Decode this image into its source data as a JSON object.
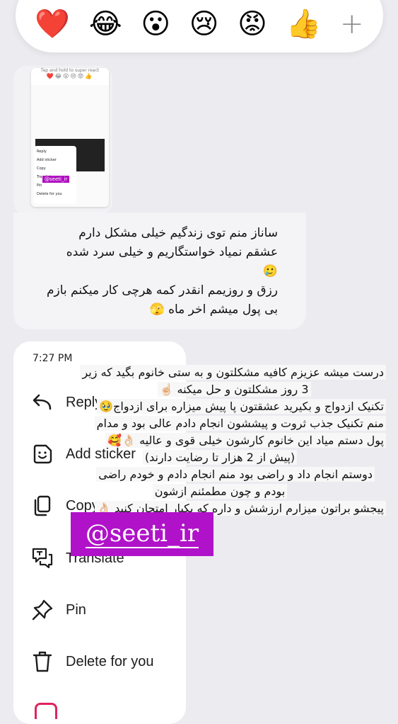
{
  "reactions": [
    {
      "emoji": "❤️",
      "name": "heart-reaction"
    },
    {
      "emoji": "😂",
      "name": "laughing-reaction"
    },
    {
      "emoji": "😮",
      "name": "wow-reaction"
    },
    {
      "emoji": "😢",
      "name": "sad-reaction"
    },
    {
      "emoji": "😡",
      "name": "angry-reaction"
    },
    {
      "emoji": "👍",
      "name": "thumbs-up-reaction"
    }
  ],
  "add_reaction": "+",
  "thumbnail": {
    "header": "Tap and hold to super react",
    "emoji_row": "❤️😂😮😢😡👍",
    "menu": [
      "Reply",
      "Add sticker",
      "Copy",
      "Translate",
      "Pin",
      "Delete for you"
    ],
    "tag": "@seeti_ir"
  },
  "message": {
    "lines": [
      "ساناز منم توی زندگیم خیلی مشکل دارم",
      "عشقم نمیاد خواستگاریم و خیلی سرد شده",
      "🥲",
      "رزق و روزیمم انقدر کمه هرچی کار میکنم بازم",
      "بی پول میشم اخر ماه 🫣"
    ]
  },
  "menu": {
    "time": "7:27 PM",
    "items": [
      {
        "label": "Reply",
        "icon": "reply-icon"
      },
      {
        "label": "Add sticker",
        "icon": "sticker-icon"
      },
      {
        "label": "Copy",
        "icon": "copy-icon"
      },
      {
        "label": "Translate",
        "icon": "translate-icon"
      },
      {
        "label": "Pin",
        "icon": "pin-icon"
      },
      {
        "label": "Delete for you",
        "icon": "trash-icon"
      }
    ]
  },
  "overlay_text": [
    "درست میشه عزیزم کافیه مشکلتون و به ستی خانوم بگید که زیر",
    "3 روز مشکلتون و حل میکنه ☝🏻",
    "تکنیک ازدواج و بکیرید عشقتون پا پیش میزاره برای ازدواج🥹",
    "منم تکنیک جذب ثروت و پیششون انجام دادم عالی بود و مدام",
    "پول دستم میاد این خانوم کارشون خیلی قوی و عالیه 👌🏻🥰",
    "(پیش از 2 هزار تا رضایت دارند)",
    "دوستم انجام داد و راضی بود منم انجام دادم و خودم راضی",
    "بودم و چون مطمئنم ازشون",
    "پیجشو براتون میزارم ارزشش و داره که یکبار امتحان کنید 👌🏻"
  ],
  "watermark": "@seeti_ir"
}
